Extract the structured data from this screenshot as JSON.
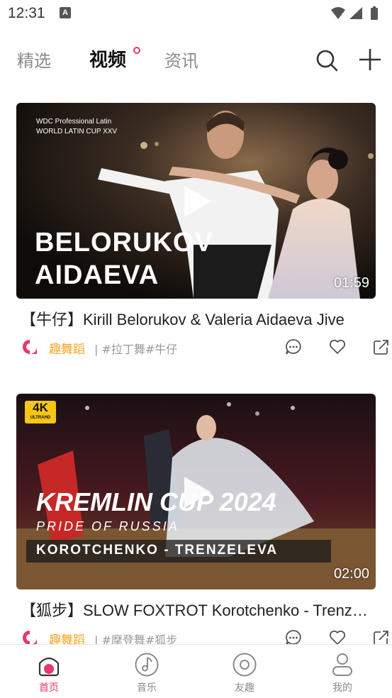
{
  "status_bar": {
    "time": "12:31",
    "notification_icon_letter": "A"
  },
  "top_tabs": [
    {
      "label": "精选",
      "active": false
    },
    {
      "label": "视频",
      "active": true
    },
    {
      "label": "资讯",
      "active": false
    }
  ],
  "videos": [
    {
      "thumbnail": {
        "small_caption_line1": "WDC Professional Latin",
        "small_caption_line2": "WORLD LATIN CUP XXV",
        "overlay_line1": "BELORUKOV",
        "overlay_line2": "AIDAEVA"
      },
      "duration": "01:59",
      "title": "【牛仔】Kirill Belorukov & Valeria Aidaeva  Jive",
      "brand": "趣舞蹈",
      "tags": "| #拉丁舞#牛仔"
    },
    {
      "thumbnail": {
        "badge_top": "4K",
        "badge_bottom": "ULTRAHD",
        "overlay_line1": "KREMLIN CUP 2024",
        "overlay_line2": "PRIDE OF RUSSIA",
        "overlay_line3": "KOROTCHENKO - TRENZELEVA"
      },
      "duration": "02:00",
      "title": "【狐步】SLOW FOXTROT  Korotchenko - Trenzeleva",
      "brand": "趣舞蹈",
      "tags": "| #摩登舞#狐步"
    }
  ],
  "bottom_nav": [
    {
      "label": "首页",
      "icon": "home-icon",
      "active": true
    },
    {
      "label": "音乐",
      "icon": "music-icon",
      "active": false
    },
    {
      "label": "友趣",
      "icon": "discover-icon",
      "active": false
    },
    {
      "label": "我的",
      "icon": "profile-icon",
      "active": false
    }
  ],
  "colors": {
    "accent": "#e6386a",
    "brand": "#f5a623",
    "muted": "#8a8a8a"
  }
}
